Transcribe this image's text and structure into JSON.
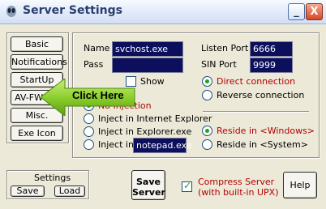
{
  "window": {
    "title": "Server Settings",
    "minimize_label": "_",
    "close_label": "X"
  },
  "sidebar": {
    "items": [
      {
        "label": "Basic"
      },
      {
        "label": "Notifications"
      },
      {
        "label": "StartUp"
      },
      {
        "label": "AV-FW Kill"
      },
      {
        "label": "Misc."
      },
      {
        "label": "Exe Icon"
      }
    ]
  },
  "basic": {
    "name_label": "Name",
    "name_value": "svchost.exe",
    "pass_label": "Pass",
    "pass_value": "",
    "show_label": "Show",
    "show_checked": false,
    "listen_port_label": "Listen Port",
    "listen_port_value": "6666",
    "sin_port_label": "SIN Port",
    "sin_port_value": "9999",
    "direct_connection_label": "Direct connection",
    "reverse_connection_label": "Reverse connection",
    "no_injection_label": "No Injection",
    "inject_ie_label": "Inject in Internet Explorer",
    "inject_explorer_label": "Inject in Explorer.exe",
    "inject_in_label": "Inject in",
    "inject_target_value": "notepad.exe",
    "reside_windows_label": "Reside in <Windows>",
    "reside_system_label": "Reside in <System>"
  },
  "overlay": {
    "click_here_label": "Click Here"
  },
  "settings_group": {
    "title": "Settings",
    "save_label": "Save",
    "load_label": "Load"
  },
  "footer": {
    "save_server_line1": "Save",
    "save_server_line2": "Server",
    "compress_line1": "Compress Server",
    "compress_line2": "(with built-in UPX)",
    "compress_checked": true,
    "help_label": "Help"
  },
  "colors": {
    "accent_red": "#b30000",
    "field_bg": "#0b0f5c",
    "check_green": "#21a121",
    "arrow_green": "#8ccf2e"
  }
}
